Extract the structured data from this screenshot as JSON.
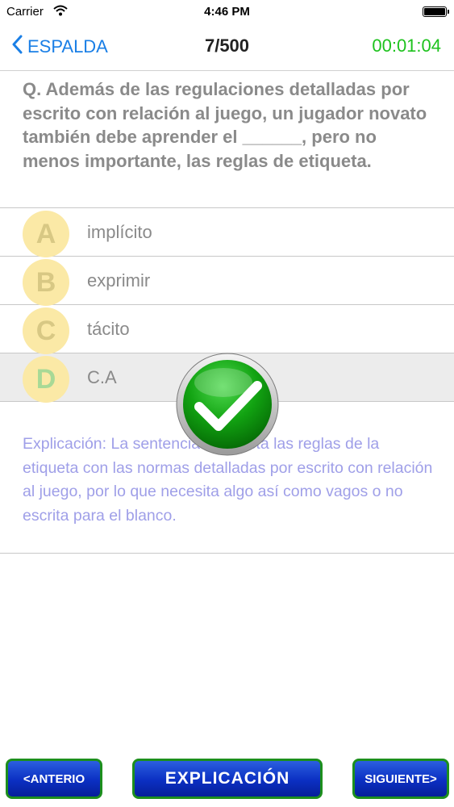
{
  "status_bar": {
    "carrier": "Carrier",
    "time": "4:46 PM"
  },
  "nav": {
    "back_label": "ESPALDA",
    "title": "7/500",
    "timer": "00:01:04",
    "timer_color": "#1dc21d"
  },
  "question": {
    "text": "Q. Además de las regulaciones detalladas por escrito con relación al juego, un jugador novato también debe aprender el ______, pero no menos importante, las reglas de etiqueta."
  },
  "options": [
    {
      "letter": "A",
      "text": "implícito"
    },
    {
      "letter": "B",
      "text": "exprimir"
    },
    {
      "letter": "C",
      "text": "tácito"
    },
    {
      "letter": "D",
      "text": "C.A",
      "selected": true,
      "correct": true
    }
  ],
  "feedback": {
    "icon": "check-icon",
    "state": "correct"
  },
  "explanation": {
    "text": "Explicación: La sentencia contrasta las reglas de la etiqueta con las normas detalladas por escrito con relación al juego, por lo que necesita algo así como vagos o no escrita para el blanco."
  },
  "buttons": {
    "prev_label": "<ANTERIO",
    "explain_label": "EXPLICACIÓN",
    "next_label": "SIGUIENTE>"
  },
  "colors": {
    "accent": "#1a7fe6",
    "explanation": "#9f9fe8",
    "button_blue": "#0b2fc2",
    "button_border": "#1d8f1d"
  }
}
